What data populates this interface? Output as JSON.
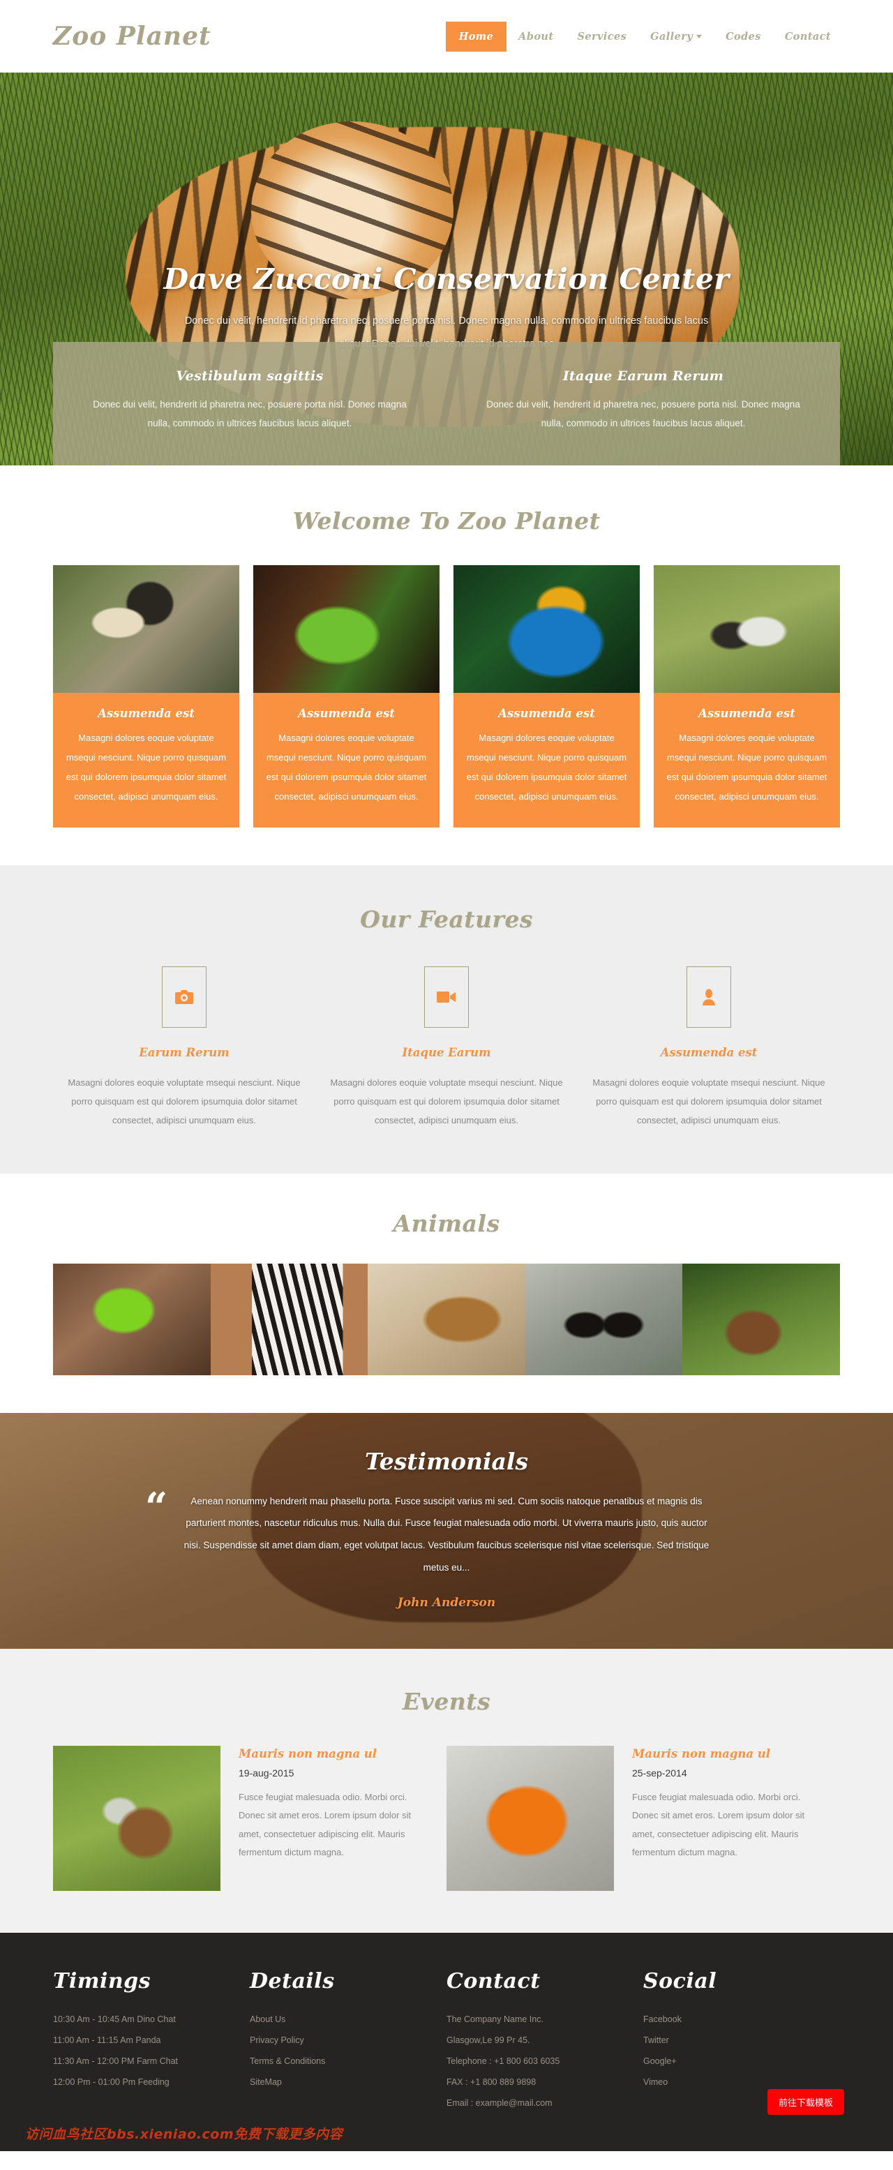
{
  "header": {
    "logo": "Zoo Planet",
    "nav": [
      {
        "label": "Home",
        "active": true
      },
      {
        "label": "About",
        "active": false
      },
      {
        "label": "Services",
        "active": false
      },
      {
        "label": "Gallery",
        "active": false,
        "caret": true
      },
      {
        "label": "Codes",
        "active": false
      },
      {
        "label": "Contact",
        "active": false
      }
    ]
  },
  "hero": {
    "title": "Dave Zucconi Conservation Center",
    "subtitle": "Donec dui velit, hendrerit id pharetra nec, posuere porta nisl. Donec magna nulla, commodo in ultrices faucibus lacus aliquet.Donec dui velit, hendrerit id pharetra nec",
    "boxes": [
      {
        "title": "Vestibulum sagittis",
        "text": "Donec dui velit, hendrerit id pharetra nec, posuere porta nisl. Donec magna nulla, commodo in ultrices faucibus lacus aliquet."
      },
      {
        "title": "Itaque Earum Rerum",
        "text": "Donec dui velit, hendrerit id pharetra nec, posuere porta nisl. Donec magna nulla, commodo in ultrices faucibus lacus aliquet."
      }
    ]
  },
  "welcome": {
    "title": "Welcome To Zoo Planet",
    "cards": [
      {
        "image": "gibbon-monkey-photo",
        "title": "Assumenda est",
        "text": "Masagni dolores eoquie voluptate msequi nesciunt. Nique porro quisquam est qui dolorem ipsumquia dolor sitamet consectet, adipisci unumquam eius."
      },
      {
        "image": "green-iguana-photo",
        "title": "Assumenda est",
        "text": "Masagni dolores eoquie voluptate msequi nesciunt. Nique porro quisquam est qui dolorem ipsumquia dolor sitamet consectet, adipisci unumquam eius."
      },
      {
        "image": "blue-macaw-photo",
        "title": "Assumenda est",
        "text": "Masagni dolores eoquie voluptate msequi nesciunt. Nique porro quisquam est qui dolorem ipsumquia dolor sitamet consectet, adipisci unumquam eius."
      },
      {
        "image": "tapir-photo",
        "title": "Assumenda est",
        "text": "Masagni dolores eoquie voluptate msequi nesciunt. Nique porro quisquam est qui dolorem ipsumquia dolor sitamet consectet, adipisci unumquam eius."
      }
    ]
  },
  "features": {
    "title": "Our Features",
    "items": [
      {
        "icon": "camera-icon",
        "title": "Earum Rerum",
        "text": "Masagni dolores eoquie voluptate msequi nesciunt. Nique porro quisquam est qui dolorem ipsumquia dolor sitamet consectet, adipisci unumquam eius."
      },
      {
        "icon": "video-camera-icon",
        "title": "Itaque Earum",
        "text": "Masagni dolores eoquie voluptate msequi nesciunt. Nique porro quisquam est qui dolorem ipsumquia dolor sitamet consectet, adipisci unumquam eius."
      },
      {
        "icon": "user-icon",
        "title": "Assumenda est",
        "text": "Masagni dolores eoquie voluptate msequi nesciunt. Nique porro quisquam est qui dolorem ipsumquia dolor sitamet consectet, adipisci unumquam eius."
      }
    ]
  },
  "animals": {
    "title": "Animals",
    "images": [
      "tree-frog-photo",
      "zebra-photo",
      "brown-bear-photo",
      "penguins-photo",
      "deer-photo"
    ]
  },
  "testimonials": {
    "title": "Testimonials",
    "quote_mark": "“",
    "quote": "Aenean nonummy hendrerit mau phasellu porta. Fusce suscipit varius mi sed. Cum sociis natoque penatibus et magnis dis parturient montes, nascetur ridiculus mus. Nulla dui. Fusce feugiat malesuada odio morbi. Ut viverra mauris justo, quis auctor nisi. Suspendisse sit amet diam diam, eget volutpat lacus. Vestibulum faucibus scelerisque nisl vitae scelerisque. Sed tristique metus eu...",
    "author": "John Anderson"
  },
  "events": {
    "title": "Events",
    "items": [
      {
        "image": "petting-zoo-photo",
        "title": "Mauris non magna ul",
        "date": "19-aug-2015",
        "text": "Fusce feugiat malesuada odio. Morbi orci. Donec sit amet eros. Lorem ipsum dolor sit amet, consectetuer adipiscing elit. Mauris fermentum dictum magna."
      },
      {
        "image": "sun-conure-parrot-photo",
        "title": "Mauris non magna ul",
        "date": "25-sep-2014",
        "text": "Fusce feugiat malesuada odio. Morbi orci. Donec sit amet eros. Lorem ipsum dolor sit amet, consectetuer adipiscing elit. Mauris fermentum dictum magna."
      }
    ]
  },
  "footer": {
    "columns": [
      {
        "heading": "Timings",
        "items": [
          "10:30 Am - 10:45 Am Dino Chat",
          "11:00 Am - 11:15 Am Panda",
          "11:30 Am - 12:00 PM Farm Chat",
          "12:00 Pm - 01:00 Pm Feeding"
        ]
      },
      {
        "heading": "Details",
        "items": [
          "About Us",
          "Privacy Policy",
          "Terms & Conditions",
          "SiteMap"
        ]
      },
      {
        "heading": "Contact",
        "items": [
          "The Company Name Inc.",
          "Glasgow,Le 99 Pr 45.",
          "Telephone : +1 800 603 6035",
          "FAX : +1 800 889 9898",
          "Email : example@mail.com"
        ]
      },
      {
        "heading": "Social",
        "items": [
          "Facebook",
          "Twitter",
          "Google+",
          "Vimeo"
        ]
      }
    ],
    "download_button": "前往下载模板",
    "watermark": "访问血鸟社区bbs.xieniao.com免费下载更多内容"
  },
  "colors": {
    "accent_orange": "#f89240",
    "heading_khaki": "#aaa488",
    "overlay_khaki": "#a6a383",
    "footer_dark": "#262423",
    "download_red": "#fb0007"
  }
}
